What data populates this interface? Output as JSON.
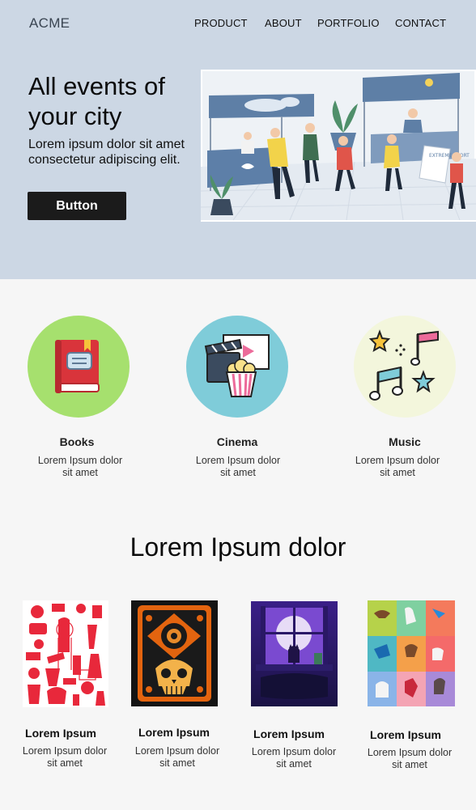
{
  "header": {
    "logo": "ACME",
    "nav": [
      "PRODUCT",
      "ABOUT",
      "PORTFOLIO",
      "CONTACT"
    ]
  },
  "hero": {
    "title": "All events of your city",
    "lead": "Lorem ipsum dolor sit amet consectetur adipiscing elit.",
    "button": "Button",
    "illustration_sign": "EXTREME SPORT"
  },
  "categories": [
    {
      "title": "Books",
      "desc": "Lorem Ipsum dolor sit amet",
      "color": "#a6e06e",
      "icon": "book-icon"
    },
    {
      "title": "Cinema",
      "desc": "Lorem Ipsum dolor sit amet",
      "color": "#7fccd9",
      "icon": "cinema-icon"
    },
    {
      "title": "Music",
      "desc": "Lorem Ipsum dolor sit amet",
      "color": "#f3f6dc",
      "icon": "music-icon"
    }
  ],
  "portfolio": {
    "title": "Lorem Ipsum dolor",
    "cards": [
      {
        "title": "Lorem Ipsum",
        "desc": "Lorem Ipsum dolor sit amet"
      },
      {
        "title": "Lorem Ipsum",
        "desc": "Lorem Ipsum dolor sit amet"
      },
      {
        "title": "Lorem Ipsum",
        "desc": "Lorem Ipsum dolor sit amet"
      },
      {
        "title": "Lorem Ipsum",
        "desc": "Lorem Ipsum dolor sit amet"
      }
    ]
  },
  "colors": {
    "hero_bg": "#ccd7e4",
    "page_bg": "#f6f6f6",
    "button_bg": "#1b1b1b",
    "accent_red": "#e8283b"
  }
}
